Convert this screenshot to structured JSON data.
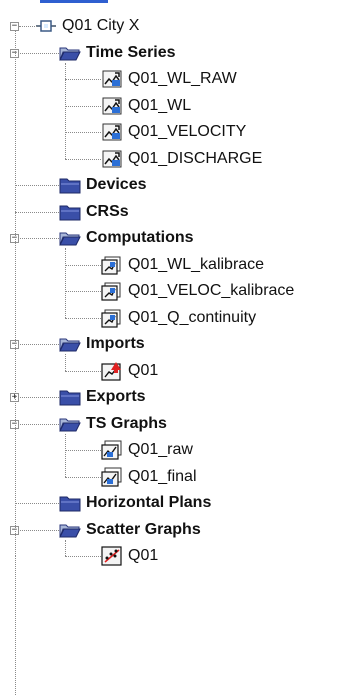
{
  "root": {
    "label": "Q01 City X",
    "icon": "station-icon"
  },
  "folders": [
    {
      "key": "timeseries",
      "label": "Time Series",
      "expanded": true,
      "children": [
        {
          "label": "Q01_WL_RAW",
          "icon": "time-series-icon"
        },
        {
          "label": "Q01_WL",
          "icon": "time-series-icon"
        },
        {
          "label": "Q01_VELOCITY",
          "icon": "time-series-icon"
        },
        {
          "label": "Q01_DISCHARGE",
          "icon": "time-series-icon"
        }
      ]
    },
    {
      "key": "devices",
      "label": "Devices",
      "expanded": null,
      "children": []
    },
    {
      "key": "crss",
      "label": "CRSs",
      "expanded": null,
      "children": []
    },
    {
      "key": "computations",
      "label": "Computations",
      "expanded": true,
      "children": [
        {
          "label": "Q01_WL_kalibrace",
          "icon": "computation-icon"
        },
        {
          "label": "Q01_VELOC_kalibrace",
          "icon": "computation-icon"
        },
        {
          "label": "Q01_Q_continuity",
          "icon": "computation-icon"
        }
      ]
    },
    {
      "key": "imports",
      "label": "Imports",
      "expanded": true,
      "children": [
        {
          "label": "Q01",
          "icon": "import-icon"
        }
      ]
    },
    {
      "key": "exports",
      "label": "Exports",
      "expanded": false,
      "children": []
    },
    {
      "key": "tsgraphs",
      "label": "TS Graphs",
      "expanded": true,
      "children": [
        {
          "label": "Q01_raw",
          "icon": "graph-icon"
        },
        {
          "label": "Q01_final",
          "icon": "graph-icon"
        }
      ]
    },
    {
      "key": "horizontalplans",
      "label": "Horizontal Plans",
      "expanded": null,
      "children": []
    },
    {
      "key": "scattergraphs",
      "label": "Scatter Graphs",
      "expanded": true,
      "children": [
        {
          "label": "Q01",
          "icon": "scatter-graph-icon"
        }
      ]
    }
  ],
  "glyphs": {
    "expanded": "−",
    "collapsed": "+"
  },
  "colors": {
    "selection_bar": "#2f5fd0",
    "folder": "#3a4fa8",
    "tree_line": "#8a8a8a"
  }
}
